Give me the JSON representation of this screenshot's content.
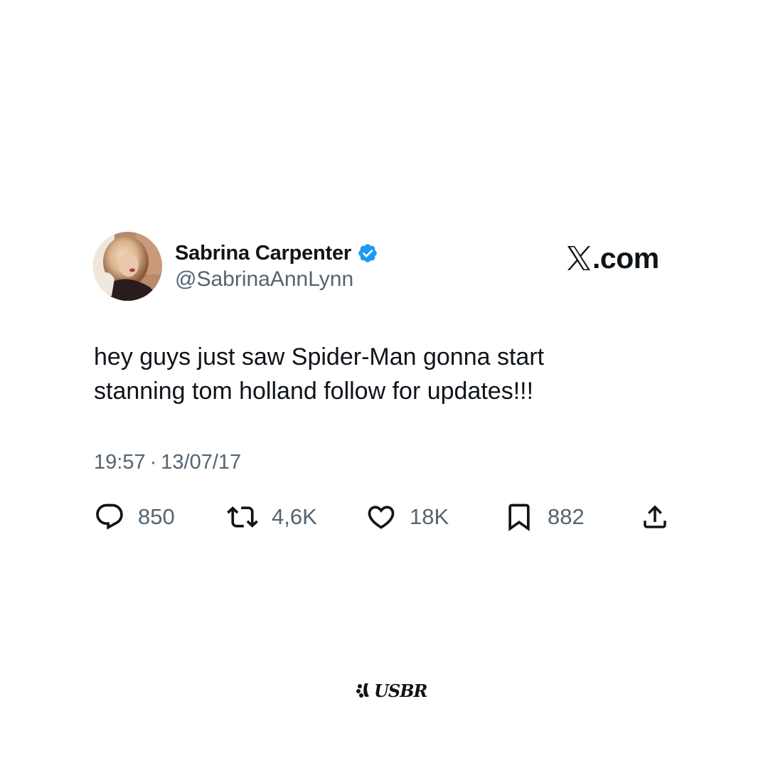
{
  "author": {
    "display_name": "Sabrina Carpenter",
    "handle": "@SabrinaAnnLynn",
    "verified": true,
    "verified_color": "#1d9bf0",
    "avatar_icon": "profile-photo"
  },
  "brand": {
    "icon": "x-logo-icon",
    "text": ".com"
  },
  "tweet": {
    "lines": [
      "hey guys just saw Spider-Man gonna start",
      "stanning tom holland follow for updates!!!"
    ],
    "time": "19:57",
    "separator": "·",
    "date": "13/07/17"
  },
  "actions": {
    "replies": {
      "icon": "reply-icon",
      "count": "850"
    },
    "retweets": {
      "icon": "retweet-icon",
      "count": "4,6K"
    },
    "likes": {
      "icon": "heart-icon",
      "count": "18K"
    },
    "bookmarks": {
      "icon": "bookmark-icon",
      "count": "882"
    },
    "share": {
      "icon": "share-icon"
    }
  },
  "watermark": {
    "icon": "usbr-logo-icon",
    "text": "USBR"
  },
  "colors": {
    "text_primary": "#0f1419",
    "text_secondary": "#536471",
    "background": "#ffffff"
  }
}
